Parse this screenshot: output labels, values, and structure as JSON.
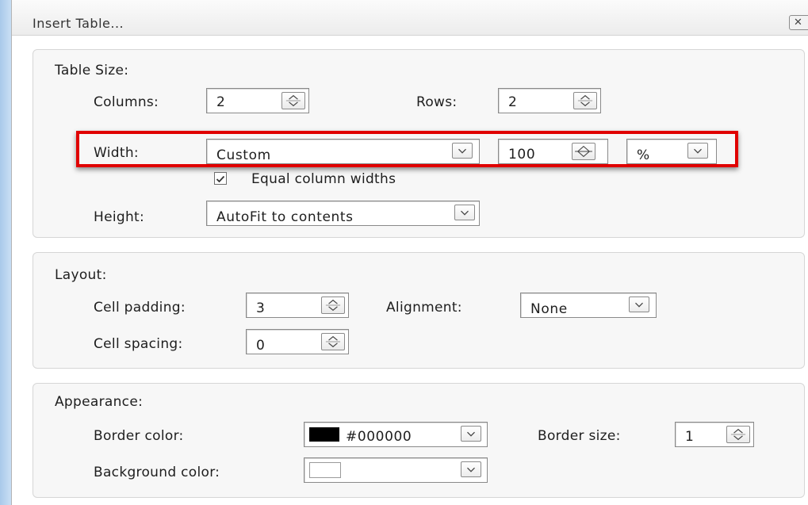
{
  "dialog": {
    "title": "Insert Table...",
    "close_label": "✕"
  },
  "table_size": {
    "heading": "Table Size:",
    "columns_label": "Columns:",
    "columns_value": "2",
    "rows_label": "Rows:",
    "rows_value": "2",
    "width_label": "Width:",
    "width_mode": "Custom",
    "width_value": "100",
    "width_unit": "%",
    "equal_columns_label": "Equal column widths",
    "equal_columns_checked": true,
    "height_label": "Height:",
    "height_mode": "AutoFit to contents"
  },
  "layout": {
    "heading": "Layout:",
    "cell_padding_label": "Cell padding:",
    "cell_padding_value": "3",
    "alignment_label": "Alignment:",
    "alignment_value": "None",
    "cell_spacing_label": "Cell spacing:",
    "cell_spacing_value": "0"
  },
  "appearance": {
    "heading": "Appearance:",
    "border_color_label": "Border color:",
    "border_color_value": "#000000",
    "border_size_label": "Border size:",
    "border_size_value": "1",
    "background_color_label": "Background color:",
    "background_color_value": "#ffffff"
  },
  "colors": {
    "highlight": "#e00000",
    "border_swatch": "#000000",
    "background_swatch": "#ffffff"
  }
}
